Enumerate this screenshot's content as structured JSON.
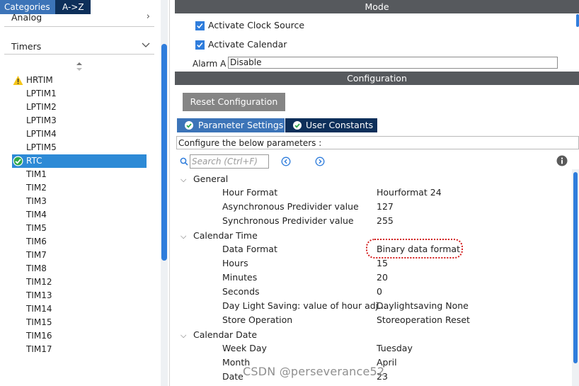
{
  "left": {
    "tabs": {
      "categories": "Categories",
      "az": "A->Z"
    },
    "categories": [
      {
        "label": "Analog"
      },
      {
        "label": "Timers"
      }
    ],
    "peripherals": [
      {
        "name": "HRTIM",
        "status": "warning"
      },
      {
        "name": "LPTIM1"
      },
      {
        "name": "LPTIM2"
      },
      {
        "name": "LPTIM3"
      },
      {
        "name": "LPTIM4"
      },
      {
        "name": "LPTIM5"
      },
      {
        "name": "RTC",
        "status": "enabled",
        "selected": true
      },
      {
        "name": "TIM1"
      },
      {
        "name": "TIM2"
      },
      {
        "name": "TIM3"
      },
      {
        "name": "TIM4"
      },
      {
        "name": "TIM5"
      },
      {
        "name": "TIM6"
      },
      {
        "name": "TIM7"
      },
      {
        "name": "TIM8"
      },
      {
        "name": "TIM12"
      },
      {
        "name": "TIM13"
      },
      {
        "name": "TIM14"
      },
      {
        "name": "TIM15"
      },
      {
        "name": "TIM16"
      },
      {
        "name": "TIM17"
      }
    ]
  },
  "mode": {
    "title": "Mode",
    "activate_clock_source": {
      "label": "Activate Clock Source",
      "checked": true
    },
    "activate_calendar": {
      "label": "Activate Calendar",
      "checked": true
    },
    "alarm_a": {
      "label": "Alarm A",
      "value": "Disable"
    }
  },
  "configuration": {
    "title": "Configuration",
    "reset_button": "Reset Configuration",
    "tabs": {
      "parameter_settings": "Parameter Settings",
      "user_constants": "User Constants"
    },
    "configure_text": "Configure the below parameters :",
    "search_placeholder": "Search (Ctrl+F)",
    "groups": [
      {
        "name": "General",
        "params": [
          {
            "name": "Hour Format",
            "value": "Hourformat 24"
          },
          {
            "name": "Asynchronous Predivider value",
            "value": "127"
          },
          {
            "name": "Synchronous Predivider value",
            "value": "255"
          }
        ]
      },
      {
        "name": "Calendar Time",
        "params": [
          {
            "name": "Data Format",
            "value": "Binary data format"
          },
          {
            "name": "Hours",
            "value": "15"
          },
          {
            "name": "Minutes",
            "value": "20"
          },
          {
            "name": "Seconds",
            "value": "0"
          },
          {
            "name": "Day Light Saving: value of hour adj...",
            "value": "Daylightsaving None"
          },
          {
            "name": "Store Operation",
            "value": "Storeoperation Reset"
          }
        ]
      },
      {
        "name": "Calendar Date",
        "params": [
          {
            "name": "Week Day",
            "value": "Tuesday"
          },
          {
            "name": "Month",
            "value": "April"
          },
          {
            "name": "Date",
            "value": "23"
          }
        ]
      }
    ]
  },
  "watermark": "CSDN @perseverance52",
  "colors": {
    "accent": "#2f7ddc",
    "tab_active": "#3c74b8",
    "tab_dark": "#0d2f5a",
    "bar": "#56595d",
    "highlight": "#d21a1a"
  }
}
